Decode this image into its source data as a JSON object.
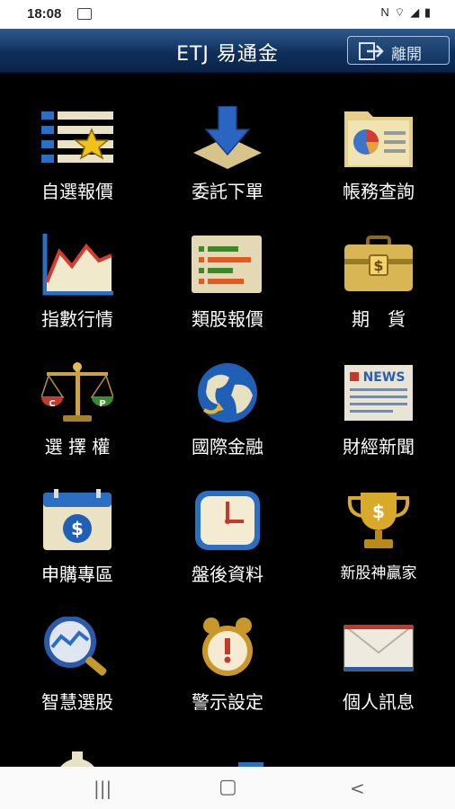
{
  "status": {
    "time": "18:08",
    "icons_text": "N ⌔ ◢ ▮"
  },
  "header": {
    "title": "ETJ 易通金",
    "exit_label": "離開"
  },
  "tiles": [
    {
      "label": "自選報價",
      "icon": "watchlist-star-icon"
    },
    {
      "label": "委託下單",
      "icon": "download-arrow-icon"
    },
    {
      "label": "帳務查詢",
      "icon": "folder-pie-chart-icon"
    },
    {
      "label": "指數行情",
      "icon": "line-chart-icon"
    },
    {
      "label": "類股報價",
      "icon": "bar-list-icon"
    },
    {
      "label": "期　貨",
      "icon": "briefcase-dollar-icon"
    },
    {
      "label": "選 擇 權",
      "icon": "balance-scale-icon"
    },
    {
      "label": "國際金融",
      "icon": "globe-icon"
    },
    {
      "label": "財經新聞",
      "icon": "newspaper-icon"
    },
    {
      "label": "申購專區",
      "icon": "calendar-dollar-icon"
    },
    {
      "label": "盤後資料",
      "icon": "clock-icon"
    },
    {
      "label": "新股神贏家",
      "icon": "trophy-icon"
    },
    {
      "label": "智慧選股",
      "icon": "magnifier-chart-icon"
    },
    {
      "label": "警示設定",
      "icon": "alarm-clock-icon"
    },
    {
      "label": "個人訊息",
      "icon": "envelope-icon"
    }
  ],
  "navbar": {
    "recent": "|||",
    "home": "▢",
    "back": "<"
  }
}
